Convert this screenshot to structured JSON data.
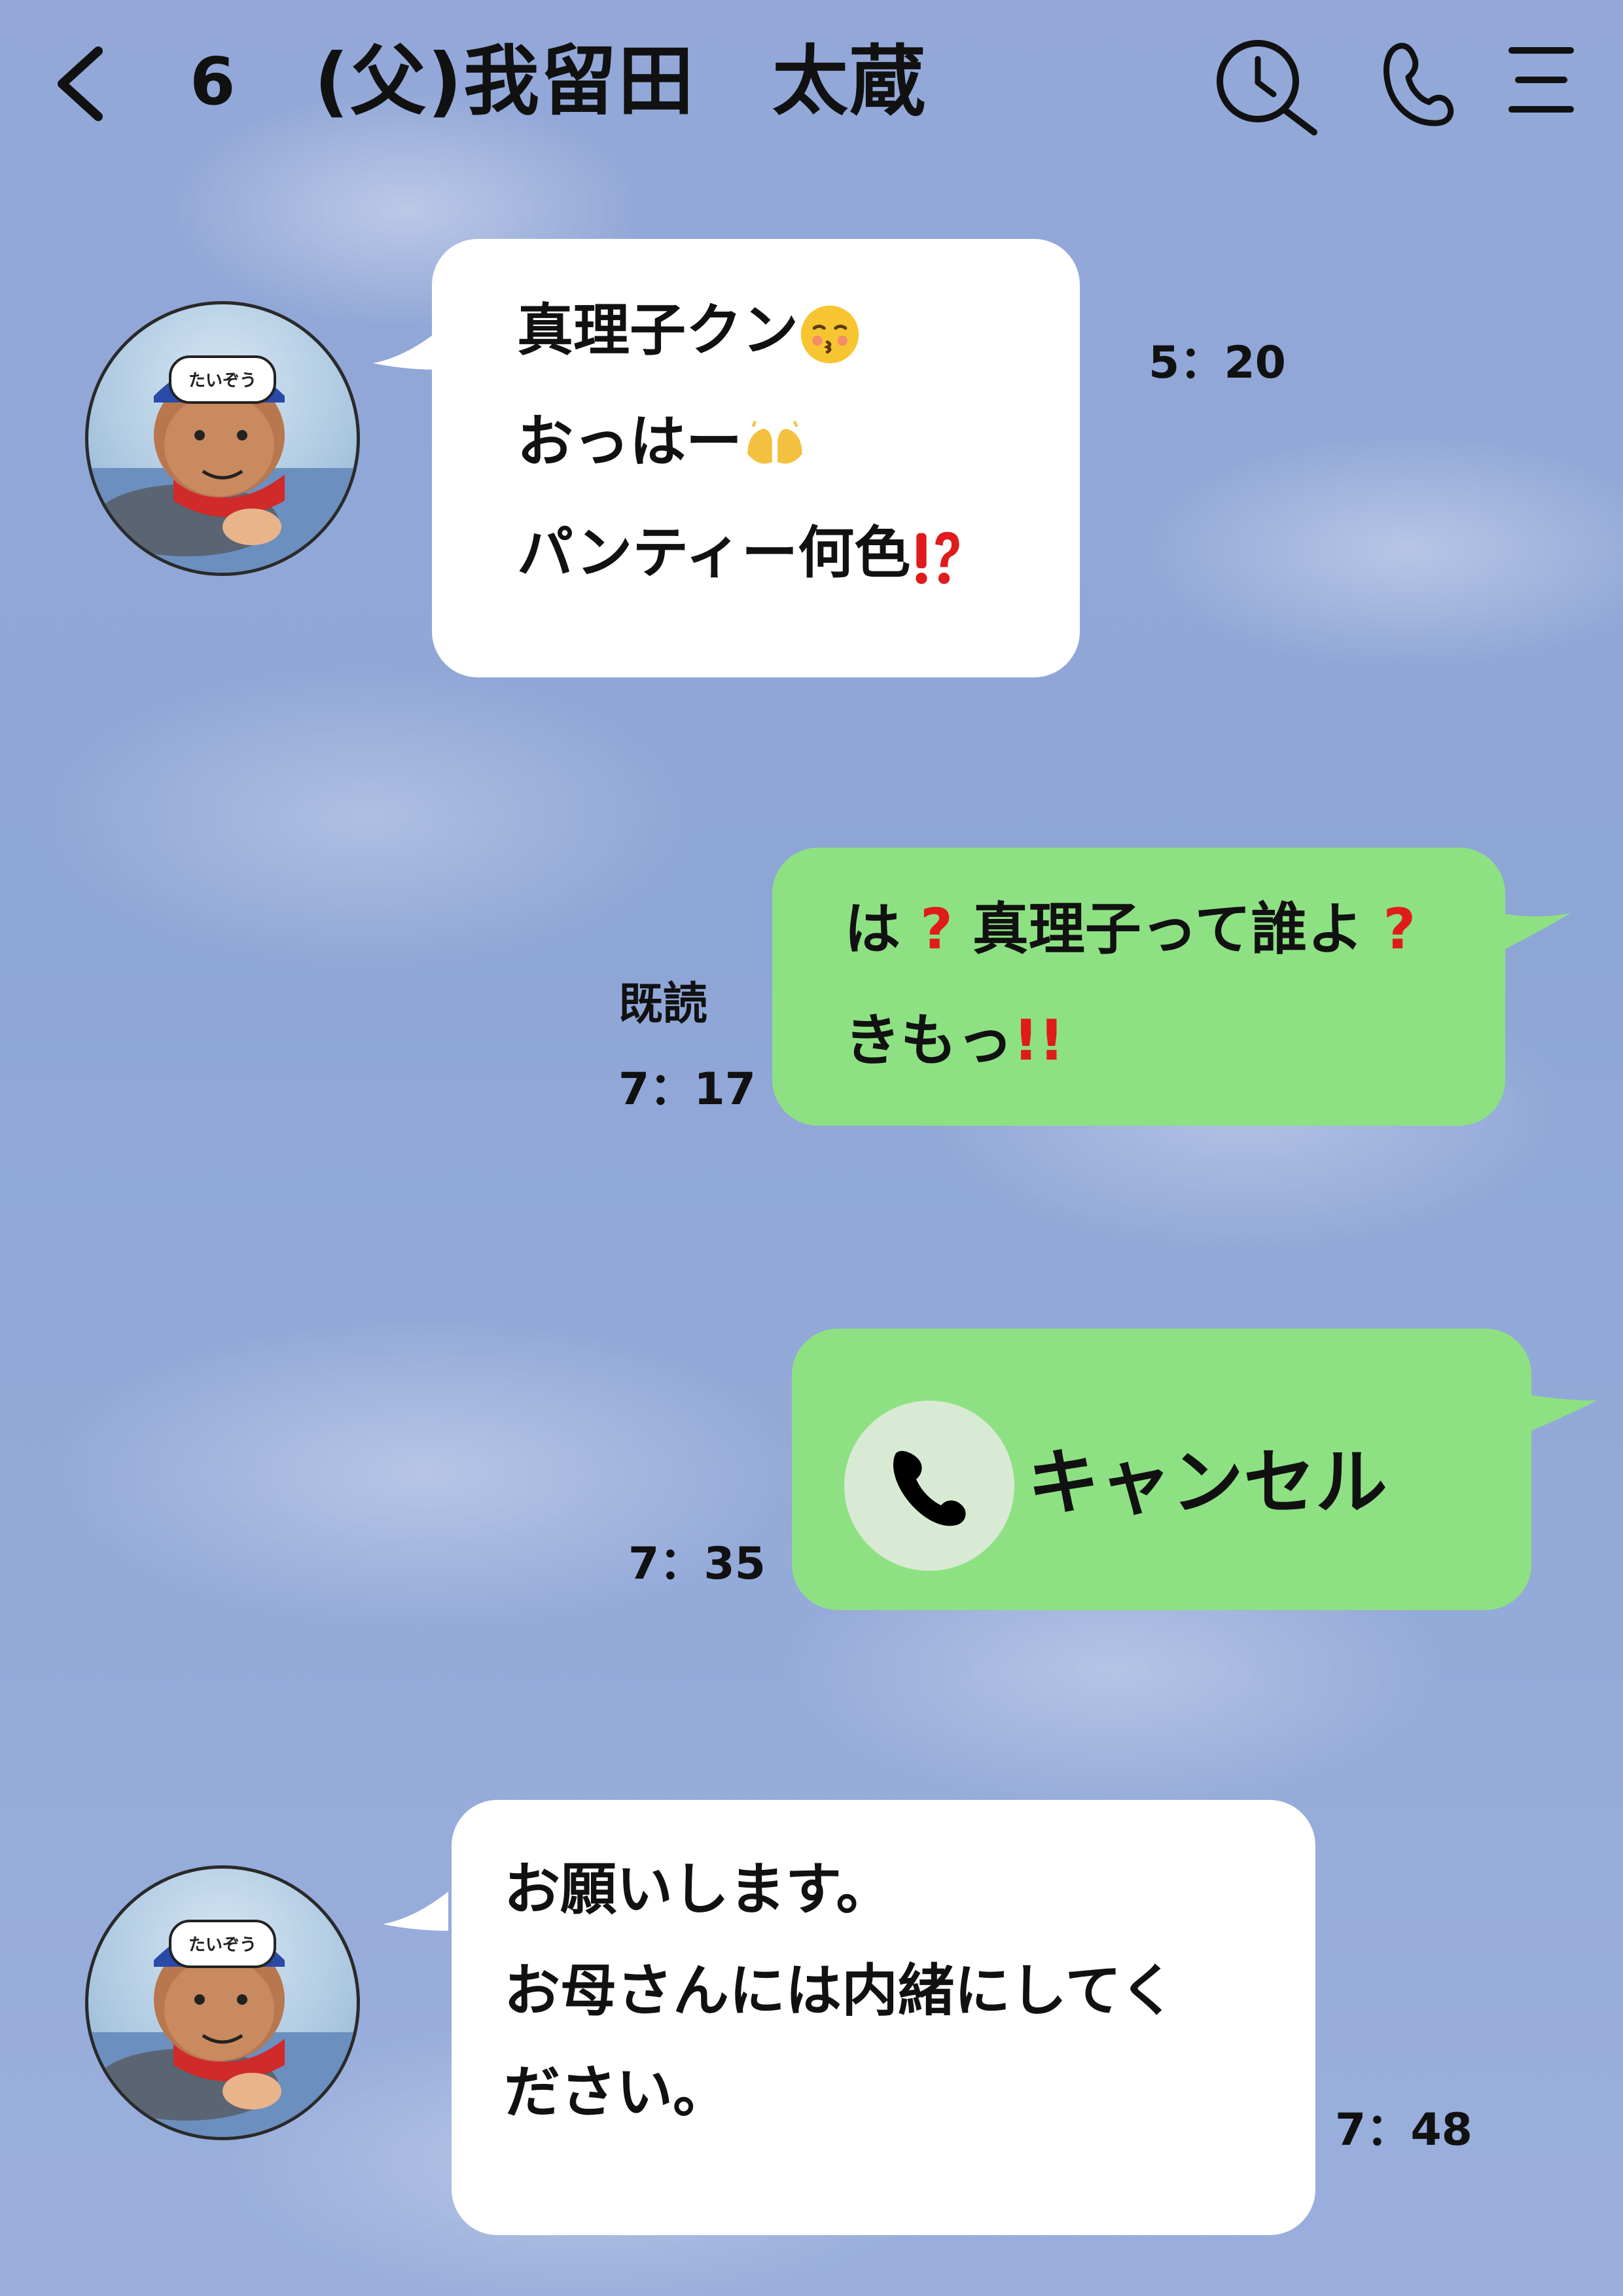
{
  "header": {
    "unread_count": "6",
    "title": "(父)我留田　太蔵"
  },
  "messages": [
    {
      "side": "left",
      "lines": [
        "真理子クン",
        "おっはー",
        "パンティー何色"
      ],
      "time": "5：20",
      "avatar_cap_text": "たいぞう"
    },
    {
      "side": "right",
      "line1_a": "は",
      "line1_b": "真理子って誰よ",
      "line2": "きもっ",
      "status": "既読",
      "time": "7：17"
    },
    {
      "side": "right",
      "call_label": "キャンセル",
      "time": "7：35"
    },
    {
      "side": "left",
      "lines": [
        "お願いします。",
        "お母さんには内緒にしてく",
        "ださい。"
      ],
      "time": "7：48",
      "avatar_cap_text": "たいぞう"
    }
  ],
  "colors": {
    "background": "#94a9d6",
    "bubble_incoming": "#ffffff",
    "bubble_outgoing": "#8ee183",
    "emphasis_red": "#e01b1b"
  },
  "icons": [
    "back-chevron-icon",
    "search-history-icon",
    "phone-icon",
    "menu-icon",
    "kiss-face-emoji",
    "raising-hands-emoji",
    "exclamation-question-emoji",
    "question-emoji",
    "double-exclamation-emoji",
    "phone-call-icon"
  ]
}
